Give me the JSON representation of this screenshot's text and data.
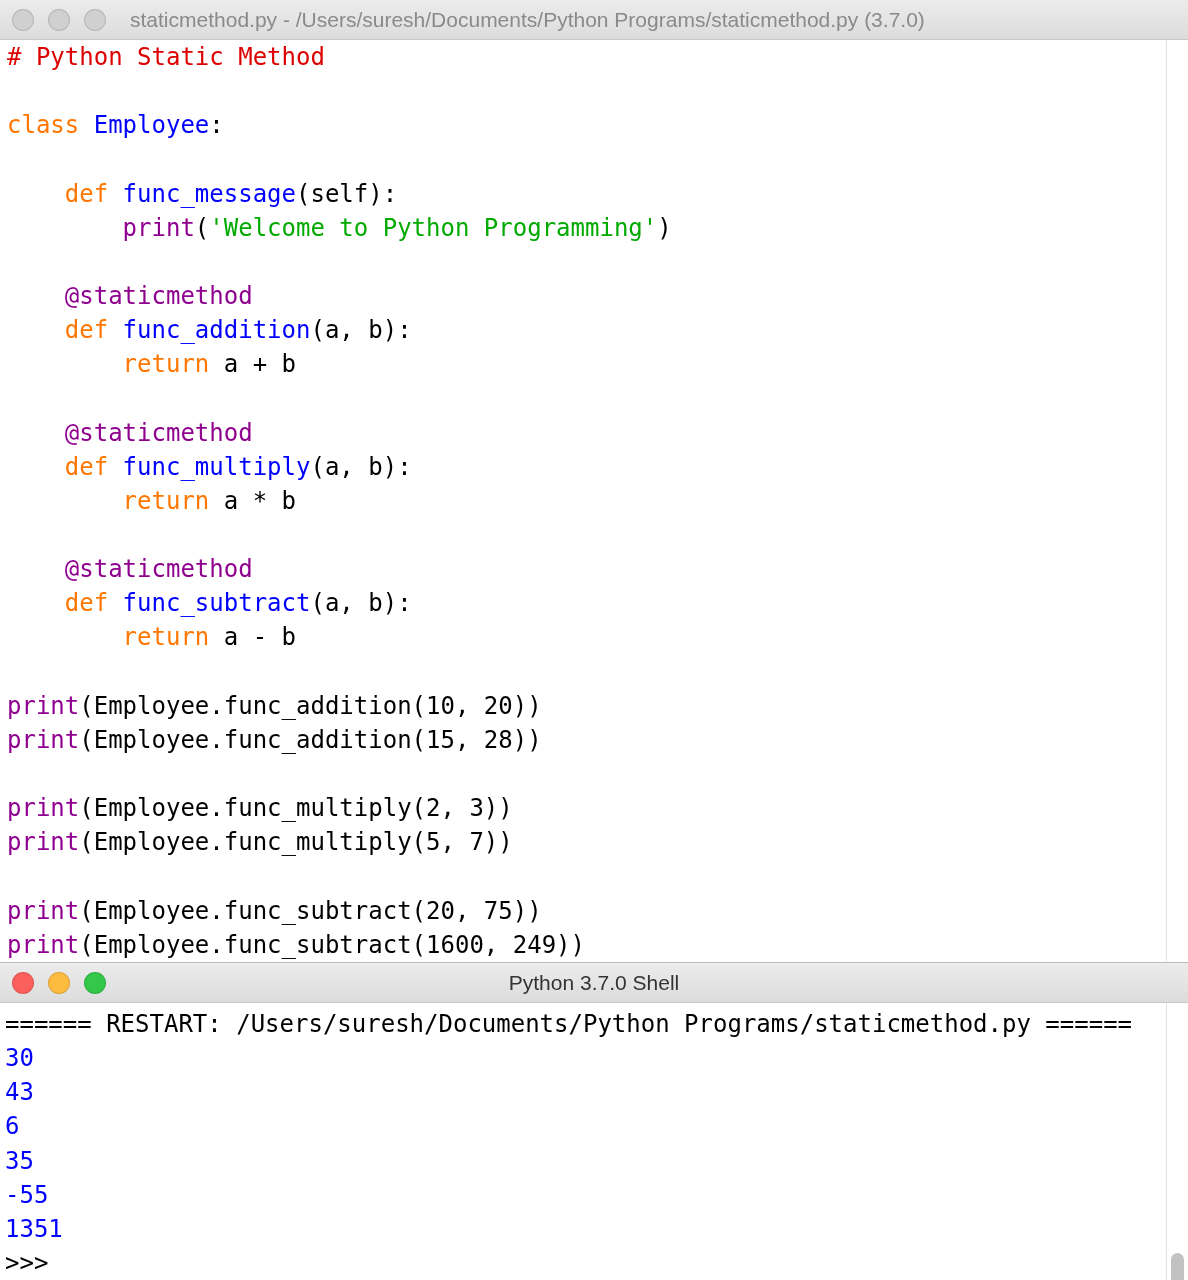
{
  "editor": {
    "title": "staticmethod.py - /Users/suresh/Documents/Python Programs/staticmethod.py (3.7.0)",
    "active": false,
    "lines": [
      {
        "kind": "code",
        "tokens": [
          {
            "kind": "comment",
            "text": "# Python Static Method"
          }
        ]
      },
      {
        "kind": "blank"
      },
      {
        "kind": "code",
        "tokens": [
          {
            "kind": "keyword",
            "text": "class "
          },
          {
            "kind": "definition",
            "text": "Employee"
          },
          {
            "kind": "plain",
            "text": ":"
          }
        ]
      },
      {
        "kind": "blank"
      },
      {
        "kind": "code",
        "tokens": [
          {
            "kind": "keyword",
            "text": "    def "
          },
          {
            "kind": "definition",
            "text": "func_message"
          },
          {
            "kind": "plain",
            "text": "(self):"
          }
        ]
      },
      {
        "kind": "code",
        "tokens": [
          {
            "kind": "builtin",
            "text": "        print"
          },
          {
            "kind": "plain",
            "text": "("
          },
          {
            "kind": "string",
            "text": "'Welcome to Python Programming'"
          },
          {
            "kind": "plain",
            "text": ")"
          }
        ]
      },
      {
        "kind": "blank"
      },
      {
        "kind": "code",
        "tokens": [
          {
            "kind": "builtin",
            "text": "    @staticmethod"
          }
        ]
      },
      {
        "kind": "code",
        "tokens": [
          {
            "kind": "keyword",
            "text": "    def "
          },
          {
            "kind": "definition",
            "text": "func_addition"
          },
          {
            "kind": "plain",
            "text": "(a, b):"
          }
        ]
      },
      {
        "kind": "code",
        "tokens": [
          {
            "kind": "keyword",
            "text": "        return"
          },
          {
            "kind": "plain",
            "text": " a + b"
          }
        ]
      },
      {
        "kind": "blank"
      },
      {
        "kind": "code",
        "tokens": [
          {
            "kind": "builtin",
            "text": "    @staticmethod"
          }
        ]
      },
      {
        "kind": "code",
        "tokens": [
          {
            "kind": "keyword",
            "text": "    def "
          },
          {
            "kind": "definition",
            "text": "func_multiply"
          },
          {
            "kind": "plain",
            "text": "(a, b):"
          }
        ]
      },
      {
        "kind": "code",
        "tokens": [
          {
            "kind": "keyword",
            "text": "        return"
          },
          {
            "kind": "plain",
            "text": " a * b"
          }
        ]
      },
      {
        "kind": "blank"
      },
      {
        "kind": "code",
        "tokens": [
          {
            "kind": "builtin",
            "text": "    @staticmethod"
          }
        ]
      },
      {
        "kind": "code",
        "tokens": [
          {
            "kind": "keyword",
            "text": "    def "
          },
          {
            "kind": "definition",
            "text": "func_subtract"
          },
          {
            "kind": "plain",
            "text": "(a, b):"
          }
        ]
      },
      {
        "kind": "code",
        "tokens": [
          {
            "kind": "keyword",
            "text": "        return"
          },
          {
            "kind": "plain",
            "text": " a - b"
          }
        ]
      },
      {
        "kind": "blank"
      },
      {
        "kind": "code",
        "tokens": [
          {
            "kind": "builtin",
            "text": "print"
          },
          {
            "kind": "plain",
            "text": "(Employee.func_addition(10, 20))"
          }
        ]
      },
      {
        "kind": "code",
        "tokens": [
          {
            "kind": "builtin",
            "text": "print"
          },
          {
            "kind": "plain",
            "text": "(Employee.func_addition(15, 28))"
          }
        ]
      },
      {
        "kind": "blank"
      },
      {
        "kind": "code",
        "tokens": [
          {
            "kind": "builtin",
            "text": "print"
          },
          {
            "kind": "plain",
            "text": "(Employee.func_multiply(2, 3))"
          }
        ]
      },
      {
        "kind": "code",
        "tokens": [
          {
            "kind": "builtin",
            "text": "print"
          },
          {
            "kind": "plain",
            "text": "(Employee.func_multiply(5, 7))"
          }
        ]
      },
      {
        "kind": "blank"
      },
      {
        "kind": "code",
        "tokens": [
          {
            "kind": "builtin",
            "text": "print"
          },
          {
            "kind": "plain",
            "text": "(Employee.func_subtract(20, 75))"
          }
        ]
      },
      {
        "kind": "code",
        "tokens": [
          {
            "kind": "builtin",
            "text": "print"
          },
          {
            "kind": "plain",
            "text": "(Employee.func_subtract(1600, 249))"
          }
        ]
      }
    ]
  },
  "shell": {
    "title": "Python 3.7.0 Shell",
    "active": true,
    "lines": [
      {
        "kind": "console",
        "text": "====== RESTART: /Users/suresh/Documents/Python Programs/staticmethod.py ======"
      },
      {
        "kind": "output",
        "text": "30"
      },
      {
        "kind": "output",
        "text": "43"
      },
      {
        "kind": "output",
        "text": "6"
      },
      {
        "kind": "output",
        "text": "35"
      },
      {
        "kind": "output",
        "text": "-55"
      },
      {
        "kind": "output",
        "text": "1351"
      },
      {
        "kind": "prompt",
        "text": ">>>"
      }
    ]
  }
}
